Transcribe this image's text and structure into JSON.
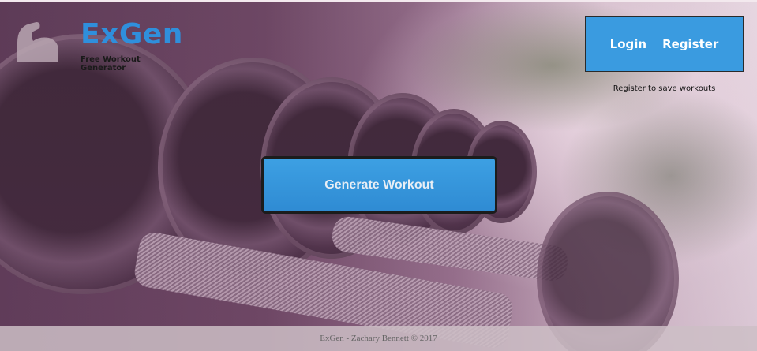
{
  "brand": {
    "title": "ExGen",
    "tagline": "Free Workout Generator",
    "icon": "flexed-arm-icon",
    "color": "#2f8fdc"
  },
  "auth": {
    "login_label": "Login",
    "register_label": "Register",
    "hint": "Register to save workouts",
    "box_color": "#3a9be0"
  },
  "main": {
    "generate_label": "Generate Workout"
  },
  "footer": {
    "text": "ExGen - Zachary Bennett © 2017"
  }
}
